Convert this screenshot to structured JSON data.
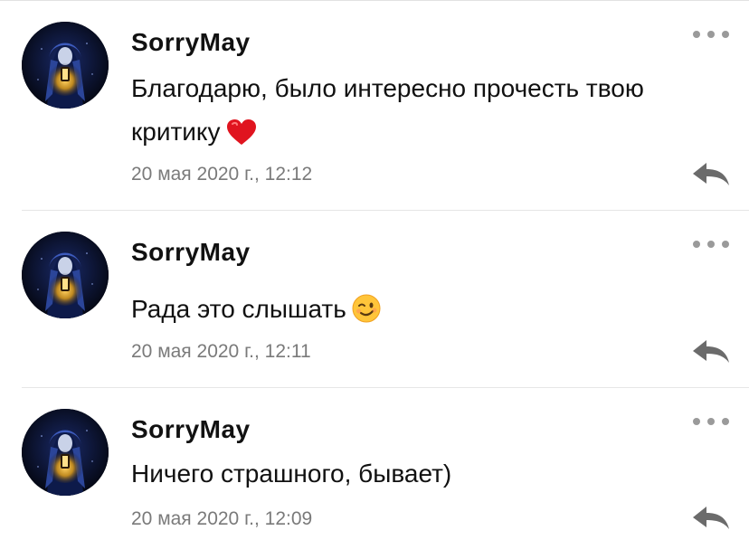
{
  "colors": {
    "text": "#111111",
    "meta": "#7a7a7a",
    "icon": "#6b6b6b",
    "divider": "#e6e6e6"
  },
  "comments": [
    {
      "author": "SorryMay",
      "text_line1": "Благодарю, было интересно прочесть твою",
      "text_line2": "критику",
      "emoji": "heart-icon",
      "date": "20 мая 2020 г., 12:12"
    },
    {
      "author": "SorryMay",
      "text": "Рада это слышать",
      "emoji": "wink-emoji-icon",
      "date": "20 мая 2020 г., 12:11"
    },
    {
      "author": "SorryMay",
      "text": "Ничего страшного, бывает)",
      "date": "20 мая 2020 г., 12:09"
    }
  ],
  "icons": {
    "more": "more-dots-icon",
    "reply": "reply-arrow-icon"
  }
}
